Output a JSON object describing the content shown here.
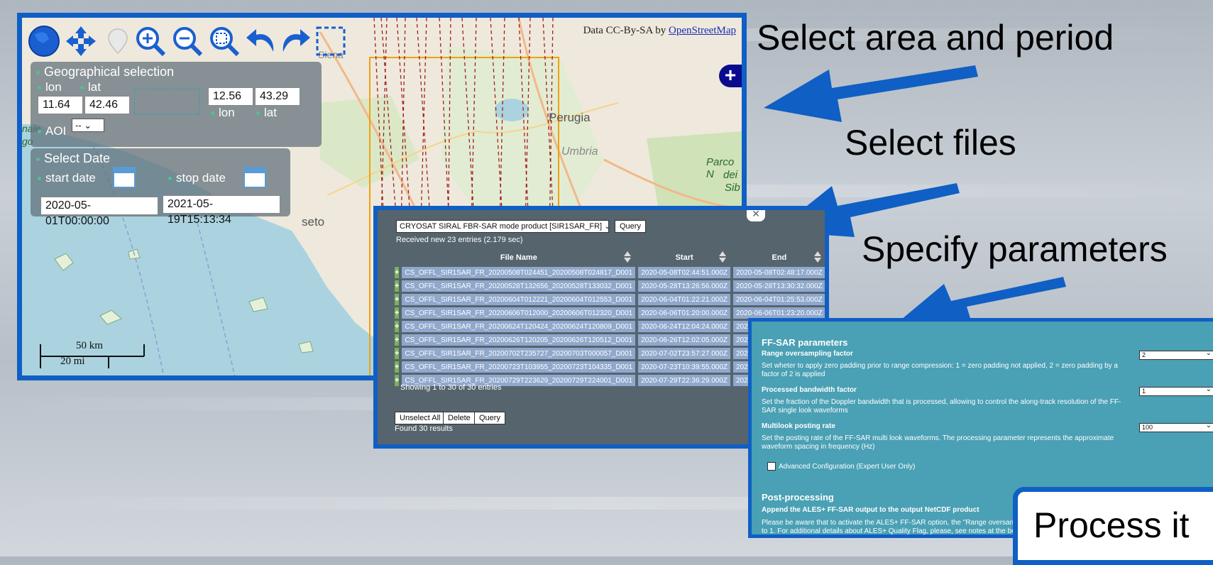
{
  "headings": {
    "select_area": "Select area and period",
    "select_files": "Select files",
    "specify_params": "Specify parameters",
    "process": "Process it"
  },
  "map": {
    "attribution_prefix": "Data CC-By-SA by ",
    "attribution_link": "OpenStreetMap",
    "labels": {
      "siena": "Siena",
      "perugia": "Perugia",
      "umbria": "Umbria",
      "parco": "Parco N",
      "parco2": "dei",
      "parco3": "Sib",
      "seto": "seto",
      "nale": "nale",
      "go": "go"
    },
    "scale_km": "50 km",
    "scale_mi": "20 mi",
    "geo": {
      "title": "Geographical selection",
      "lon_label": "lon",
      "lat_label": "lat",
      "lon1": "11.64",
      "lat1": "42.46",
      "lon2": "12.56",
      "lat2": "43.29",
      "aoi_label": "AOI",
      "aoi_value": "--"
    },
    "date": {
      "title": "Select Date",
      "start_label": "start date",
      "stop_label": "stop date",
      "start_value": "2020-05-01T00:00:00",
      "stop_value": "2021-05-19T15:13:34"
    }
  },
  "files": {
    "product_select": "CRYOSAT SIRAL FBR-SAR mode product [SIR1SAR_FR]",
    "query_label": "Query",
    "received": "Received new 23 entries (2.179 sec)",
    "columns": [
      "File Name",
      "Start",
      "End"
    ],
    "rows": [
      [
        "CS_OFFL_SIR1SAR_FR_20200508T024451_20200508T024817_D001",
        "2020-05-08T02:44:51.000Z",
        "2020-05-08T02:48:17.000Z"
      ],
      [
        "CS_OFFL_SIR1SAR_FR_20200528T132656_20200528T133032_D001",
        "2020-05-28T13:26:56.000Z",
        "2020-05-28T13:30:32.000Z"
      ],
      [
        "CS_OFFL_SIR1SAR_FR_20200604T012221_20200604T012553_D001",
        "2020-06-04T01:22:21.000Z",
        "2020-06-04T01:25:53.000Z"
      ],
      [
        "CS_OFFL_SIR1SAR_FR_20200606T012000_20200606T012320_D001",
        "2020-06-06T01:20:00.000Z",
        "2020-06-06T01:23:20.000Z"
      ],
      [
        "CS_OFFL_SIR1SAR_FR_20200624T120424_20200624T120809_D001",
        "2020-06-24T12:04:24.000Z",
        "202"
      ],
      [
        "CS_OFFL_SIR1SAR_FR_20200626T120205_20200626T120512_D001",
        "2020-06-26T12:02:05.000Z",
        "202"
      ],
      [
        "CS_OFFL_SIR1SAR_FR_20200702T235727_20200703T000057_D001",
        "2020-07-02T23:57:27.000Z",
        "202"
      ],
      [
        "CS_OFFL_SIR1SAR_FR_20200723T103955_20200723T104335_D001",
        "2020-07-23T10:39:55.000Z",
        "202"
      ],
      [
        "CS_OFFL_SIR1SAR_FR_20200729T223629_20200729T224001_D001",
        "2020-07-29T22:36:29.000Z",
        "202"
      ]
    ],
    "showing": "Showing 1 to 30 of 30 entries",
    "unselect_all": "Unselect All",
    "delete": "Delete",
    "query2": "Query",
    "found": "Found 30 results"
  },
  "params": {
    "title": "FF-SAR parameters",
    "range_label": "Range oversampling factor",
    "range_desc": "Set wheter to apply zero padding prior to range compression: 1 = zero padding not applied, 2 = zero padding by a factor of 2 is applied",
    "range_value": "2",
    "bandwidth_label": "Processed bandwidth factor",
    "bandwidth_desc": "Set the fraction of the Doppler bandwidth that is processed, allowing to control the along-track resolution of the FF-SAR single look waveforms",
    "bandwidth_value": "1",
    "multilook_label": "Multilook posting rate",
    "multilook_desc": "Set the posting rate of the FF-SAR multi look waveforms. The processing parameter represents the approximate waveform spacing in frequency (Hz)",
    "multilook_value": "100",
    "advanced_label": "Advanced Configuration (Expert User Only)",
    "post_title": "Post-processing",
    "append_label": "Append the ALES+ FF-SAR output to the output NetCDF product",
    "append_desc1": "Please be aware that to activate the ALES+ FF-SAR option, the \"Range oversamp",
    "append_desc2": "to 1. For additional details about ALES+ Quality Flag, please, see notes at the bo"
  }
}
